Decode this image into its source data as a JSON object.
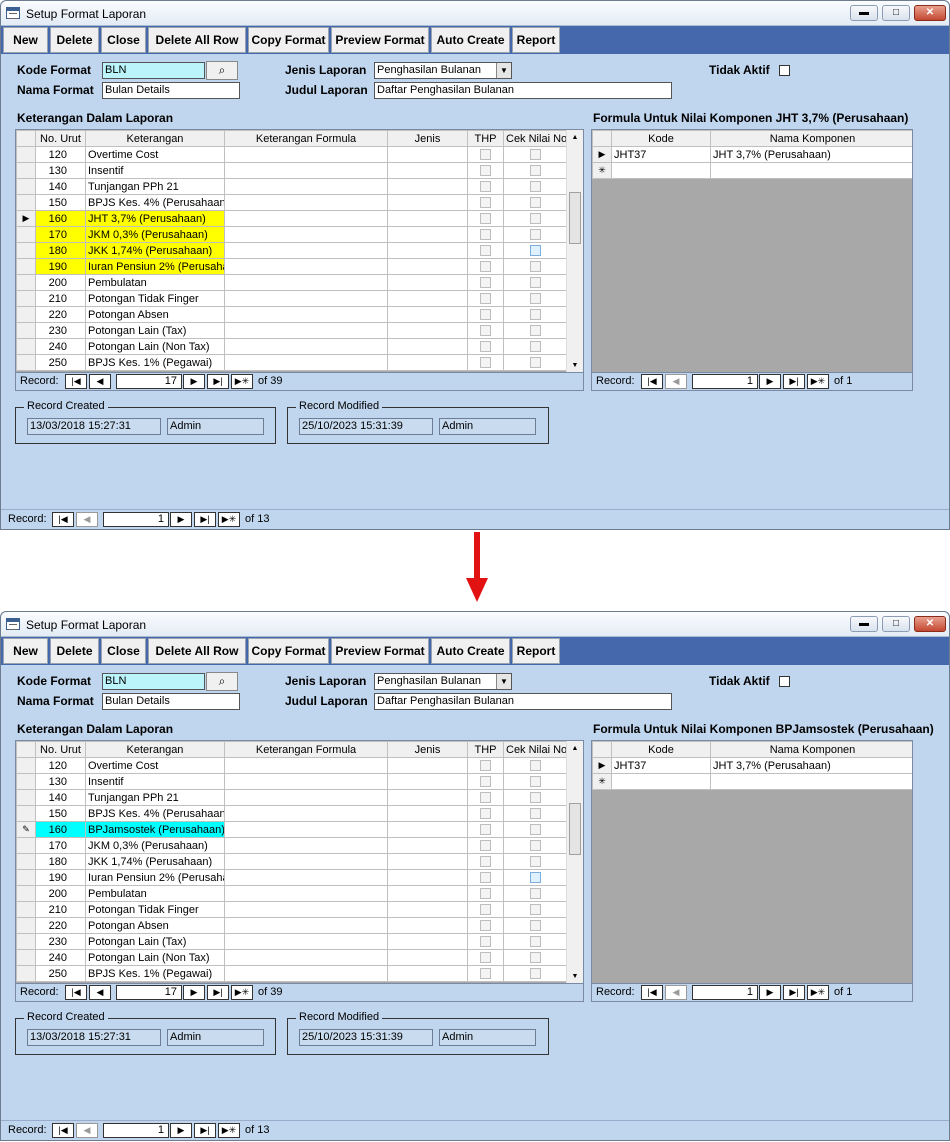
{
  "screens": [
    {
      "window_title": "Setup Format Laporan",
      "toolbar": [
        "New",
        "Delete",
        "Close",
        "Delete All Row",
        "Copy Format",
        "Preview Format",
        "Auto Create",
        "Report"
      ],
      "labels": {
        "kode_format": "Kode Format",
        "nama_format": "Nama Format",
        "jenis_laporan": "Jenis Laporan",
        "judul_laporan": "Judul Laporan",
        "tidak_aktif": "Tidak Aktif",
        "keterangan_title": "Keterangan Dalam Laporan",
        "formula_title": "Formula Untuk Nilai Komponen JHT 3,7% (Perusahaan)",
        "record_created": "Record Created",
        "record_modified": "Record Modified"
      },
      "fields": {
        "kode_format": "BLN",
        "nama_format": "Bulan Details",
        "jenis_laporan": "Penghasilan Bulanan",
        "judul_laporan": "Daftar Penghasilan Bulanan",
        "created_date": "13/03/2018 15:27:31",
        "created_by": "Admin",
        "modified_date": "25/10/2023 15:31:39",
        "modified_by": "Admin"
      },
      "main_grid": {
        "headers": [
          "No. Urut",
          "Keterangan",
          "Keterangan Formula",
          "Jenis",
          "THP",
          "Cek Nilai Nol"
        ],
        "rows": [
          {
            "no": "120",
            "ket": "Overtime Cost",
            "sel": "",
            "hl": "",
            "blue": false
          },
          {
            "no": "130",
            "ket": "Insentif",
            "sel": "",
            "hl": "",
            "blue": false
          },
          {
            "no": "140",
            "ket": "Tunjangan PPh 21",
            "sel": "",
            "hl": "",
            "blue": false
          },
          {
            "no": "150",
            "ket": "BPJS Kes. 4% (Perusahaan",
            "sel": "",
            "hl": "",
            "blue": false
          },
          {
            "no": "160",
            "ket": "JHT 3,7% (Perusahaan)",
            "sel": "▶",
            "hl": "yellow",
            "blue": false
          },
          {
            "no": "170",
            "ket": "JKM 0,3% (Perusahaan)",
            "sel": "",
            "hl": "yellow",
            "blue": false
          },
          {
            "no": "180",
            "ket": "JKK 1,74% (Perusahaan)",
            "sel": "",
            "hl": "yellow",
            "blue": true
          },
          {
            "no": "190",
            "ket": "Iuran Pensiun 2% (Perusaha",
            "sel": "",
            "hl": "yellow",
            "blue": false
          },
          {
            "no": "200",
            "ket": "Pembulatan",
            "sel": "",
            "hl": "",
            "blue": false
          },
          {
            "no": "210",
            "ket": "Potongan Tidak Finger",
            "sel": "",
            "hl": "",
            "blue": false
          },
          {
            "no": "220",
            "ket": "Potongan Absen",
            "sel": "",
            "hl": "",
            "blue": false
          },
          {
            "no": "230",
            "ket": "Potongan Lain (Tax)",
            "sel": "",
            "hl": "",
            "blue": false
          },
          {
            "no": "240",
            "ket": "Potongan Lain (Non Tax)",
            "sel": "",
            "hl": "",
            "blue": false
          },
          {
            "no": "250",
            "ket": "BPJS Kes. 1% (Pegawai)",
            "sel": "",
            "hl": "",
            "blue": false
          }
        ],
        "nav": {
          "label": "Record:",
          "pos": "17",
          "of": "of  39"
        }
      },
      "formula_grid": {
        "headers": [
          "Kode",
          "Nama Komponen"
        ],
        "rows": [
          {
            "sel": "▶",
            "kode": "JHT37",
            "nama": "JHT 3,7% (Perusahaan)"
          },
          {
            "sel": "✳",
            "kode": "",
            "nama": ""
          }
        ],
        "nav": {
          "label": "Record:",
          "pos": "1",
          "of": "of  1"
        }
      },
      "form_nav": {
        "label": "Record:",
        "pos": "1",
        "of": "of  13"
      }
    },
    {
      "window_title": "Setup Format Laporan",
      "toolbar": [
        "New",
        "Delete",
        "Close",
        "Delete All Row",
        "Copy Format",
        "Preview Format",
        "Auto Create",
        "Report"
      ],
      "labels": {
        "kode_format": "Kode Format",
        "nama_format": "Nama Format",
        "jenis_laporan": "Jenis Laporan",
        "judul_laporan": "Judul Laporan",
        "tidak_aktif": "Tidak Aktif",
        "keterangan_title": "Keterangan Dalam Laporan",
        "formula_title": "Formula Untuk Nilai Komponen BPJamsostek (Perusahaan)",
        "record_created": "Record Created",
        "record_modified": "Record Modified"
      },
      "fields": {
        "kode_format": "BLN",
        "nama_format": "Bulan Details",
        "jenis_laporan": "Penghasilan Bulanan",
        "judul_laporan": "Daftar Penghasilan Bulanan",
        "created_date": "13/03/2018 15:27:31",
        "created_by": "Admin",
        "modified_date": "25/10/2023 15:31:39",
        "modified_by": "Admin"
      },
      "main_grid": {
        "headers": [
          "No. Urut",
          "Keterangan",
          "Keterangan Formula",
          "Jenis",
          "THP",
          "Cek Nilai Nol"
        ],
        "rows": [
          {
            "no": "120",
            "ket": "Overtime Cost",
            "sel": "",
            "hl": "",
            "blue": false
          },
          {
            "no": "130",
            "ket": "Insentif",
            "sel": "",
            "hl": "",
            "blue": false
          },
          {
            "no": "140",
            "ket": "Tunjangan PPh 21",
            "sel": "",
            "hl": "",
            "blue": false
          },
          {
            "no": "150",
            "ket": "BPJS Kes. 4% (Perusahaan",
            "sel": "",
            "hl": "",
            "blue": false
          },
          {
            "no": "160",
            "ket": "BPJamsostek (Perusahaan)",
            "sel": "✎",
            "hl": "cyan",
            "blue": false
          },
          {
            "no": "170",
            "ket": "JKM 0,3% (Perusahaan)",
            "sel": "",
            "hl": "",
            "blue": false
          },
          {
            "no": "180",
            "ket": "JKK 1,74% (Perusahaan)",
            "sel": "",
            "hl": "",
            "blue": false
          },
          {
            "no": "190",
            "ket": "Iuran Pensiun 2% (Perusaha",
            "sel": "",
            "hl": "",
            "blue": true
          },
          {
            "no": "200",
            "ket": "Pembulatan",
            "sel": "",
            "hl": "",
            "blue": false
          },
          {
            "no": "210",
            "ket": "Potongan Tidak Finger",
            "sel": "",
            "hl": "",
            "blue": false
          },
          {
            "no": "220",
            "ket": "Potongan Absen",
            "sel": "",
            "hl": "",
            "blue": false
          },
          {
            "no": "230",
            "ket": "Potongan Lain (Tax)",
            "sel": "",
            "hl": "",
            "blue": false
          },
          {
            "no": "240",
            "ket": "Potongan Lain (Non Tax)",
            "sel": "",
            "hl": "",
            "blue": false
          },
          {
            "no": "250",
            "ket": "BPJS Kes. 1% (Pegawai)",
            "sel": "",
            "hl": "",
            "blue": false
          }
        ],
        "nav": {
          "label": "Record:",
          "pos": "17",
          "of": "of  39"
        }
      },
      "formula_grid": {
        "headers": [
          "Kode",
          "Nama Komponen"
        ],
        "rows": [
          {
            "sel": "▶",
            "kode": "JHT37",
            "nama": "JHT 3,7% (Perusahaan)"
          },
          {
            "sel": "✳",
            "kode": "",
            "nama": ""
          }
        ],
        "nav": {
          "label": "Record:",
          "pos": "1",
          "of": "of  1"
        }
      },
      "form_nav": {
        "label": "Record:",
        "pos": "1",
        "of": "of  13"
      }
    }
  ],
  "icons": {
    "search": "search-icon",
    "dropdown": "chevron-down-icon",
    "record_selector": "record-selector-icon",
    "edit_pencil": "pencil-icon",
    "new_record": "new-record-icon",
    "nav_first": "first-record-icon",
    "nav_prev": "prev-record-icon",
    "nav_next": "next-record-icon",
    "nav_last": "last-record-icon",
    "nav_new": "new-nav-record-icon"
  },
  "colors": {
    "form_background": "#c0d6ee",
    "toolbar": "#4568ad",
    "highlight_yellow": "#ffff00",
    "highlight_cyan": "#00ffff",
    "arrow": "#e21212"
  }
}
